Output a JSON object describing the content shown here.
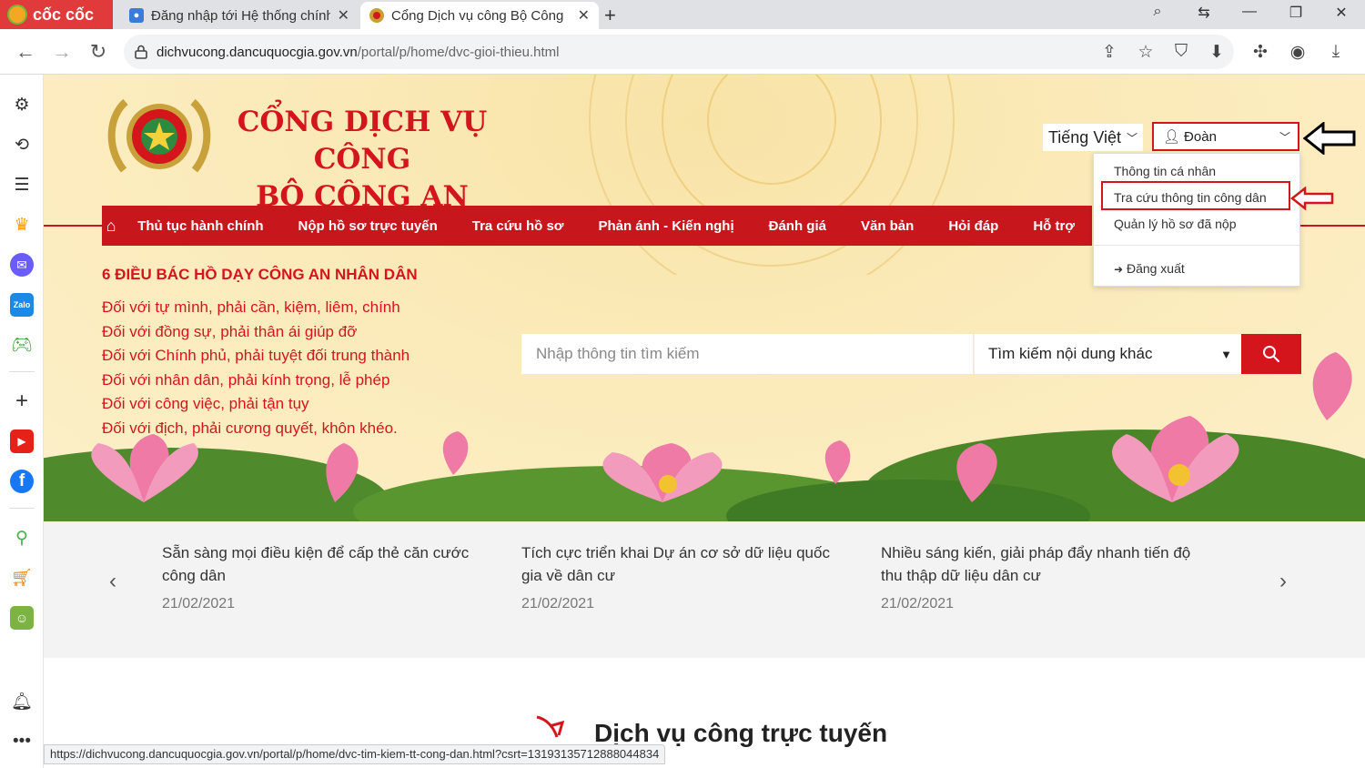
{
  "browser": {
    "brand": "cốc cốc",
    "tabs": [
      {
        "title": "Đăng nhập tới Hệ thống chính",
        "active": false
      },
      {
        "title": "Cổng Dịch vụ công Bộ Công",
        "active": true
      }
    ],
    "url_host": "dichvucong.dancuquocgia.gov.vn",
    "url_path": "/portal/p/home/dvc-gioi-thieu.html",
    "status_url": "https://dichvucong.dancuquocgia.gov.vn/portal/p/home/dvc-tim-kiem-tt-cong-dan.html?csrt=13193135712888044834"
  },
  "site": {
    "title_line1": "CỔNG DỊCH VỤ CÔNG",
    "title_line2": "BỘ CÔNG AN",
    "language": "Tiếng Việt",
    "user_name": "Đoàn"
  },
  "user_menu": {
    "items": [
      "Thông tin cá nhân",
      "Tra cứu thông tin công dân",
      "Quản lý hồ sơ đã nộp"
    ],
    "logout": "Đăng xuất"
  },
  "nav": {
    "items": [
      "Thủ tục hành chính",
      "Nộp hồ sơ trực tuyến",
      "Tra cứu hồ sơ",
      "Phản ánh - Kiến nghị",
      "Đánh giá",
      "Văn bản",
      "Hỏi đáp",
      "Hỗ trợ"
    ]
  },
  "quotes": {
    "title": "6 ĐIỀU BÁC HỒ DẠY CÔNG AN NHÂN DÂN",
    "lines": [
      "Đối với tự mình, phải cần, kiệm, liêm, chính",
      "Đối với đồng sự, phải thân ái giúp đỡ",
      "Đối với Chính phủ, phải tuyệt đối trung thành",
      "Đối với nhân dân, phải kính trọng, lễ phép",
      "Đối với công việc, phải tận tụy",
      "Đối với địch, phải cương quyết, khôn khéo."
    ]
  },
  "search": {
    "placeholder": "Nhập thông tin tìm kiếm",
    "select_value": "Tìm kiếm nội dung khác"
  },
  "news": [
    {
      "title": "Sẵn sàng mọi điều kiện để cấp thẻ căn cước công dân",
      "date": "21/02/2021"
    },
    {
      "title": "Tích cực triển khai Dự án cơ sở dữ liệu quốc gia về dân cư",
      "date": "21/02/2021"
    },
    {
      "title": "Nhiều sáng kiến, giải pháp đẩy nhanh tiến độ thu thập dữ liệu dân cư",
      "date": "21/02/2021"
    }
  ],
  "section": {
    "title": "Dịch vụ công trực tuyến"
  },
  "colors": {
    "brand_red": "#d4161c",
    "nav_red": "#c8161d",
    "hero_bg": "#fbeab8"
  }
}
